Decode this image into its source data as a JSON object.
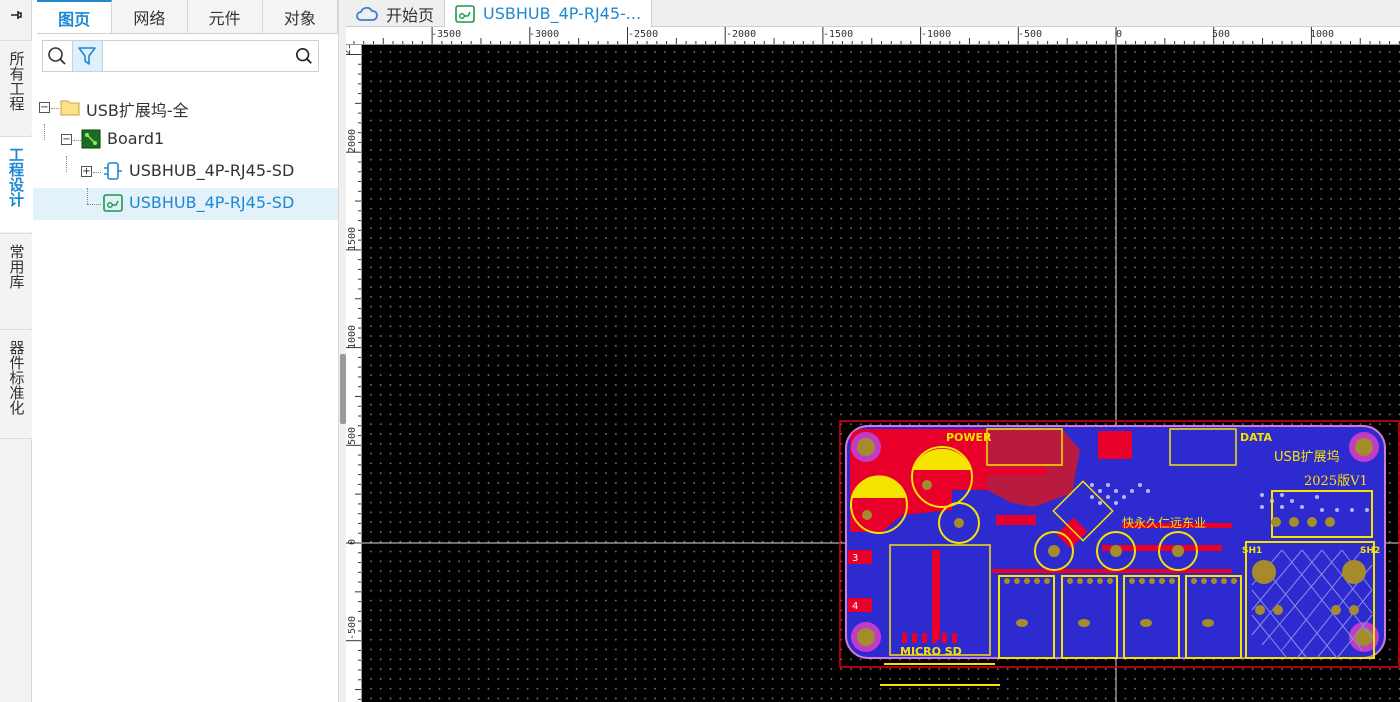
{
  "rail": {
    "pin_glyph": "📌",
    "tabs": [
      {
        "label": "所有工程"
      },
      {
        "label": "工程设计"
      },
      {
        "label": "常用库"
      },
      {
        "label": "器件标准化"
      }
    ]
  },
  "panel": {
    "tabs": [
      "图页",
      "网络",
      "元件",
      "对象"
    ],
    "search": {
      "placeholder": "",
      "value": ""
    },
    "tree": [
      {
        "label": "USB扩展坞-全"
      },
      {
        "label": "Board1"
      },
      {
        "label": "USBHUB_4P-RJ45-SD"
      },
      {
        "label": "USBHUB_4P-RJ45-SD"
      }
    ]
  },
  "doctabs": [
    {
      "label": "开始页"
    },
    {
      "label": "USBHUB_4P-RJ45-..."
    }
  ],
  "ruler": {
    "h_labels": [
      "-3500",
      "-3000",
      "-2500",
      "-2000",
      "-1500",
      "-1000",
      "-500",
      "0",
      "500",
      "1000"
    ],
    "v_labels": [
      "2500",
      "2000",
      "1500",
      "1000",
      "500",
      "0",
      "-500"
    ]
  },
  "pcb": {
    "silk": {
      "power": "POWER",
      "data": "DATA",
      "title": "USB扩展坞",
      "version": "2025版V1",
      "micro_sd": "MICRO SD",
      "sh1": "SH1",
      "sh2": "SH2",
      "pad3": "3",
      "pad4": "4",
      "note": "快永久仁远东业"
    }
  },
  "colors": {
    "accent": "#1e88d2",
    "board_blue": "#2d2ad0",
    "copper_red": "#e8002a",
    "silk_yellow": "#f5e300",
    "outline": "#e60012",
    "board_edge": "#d27ad8"
  }
}
